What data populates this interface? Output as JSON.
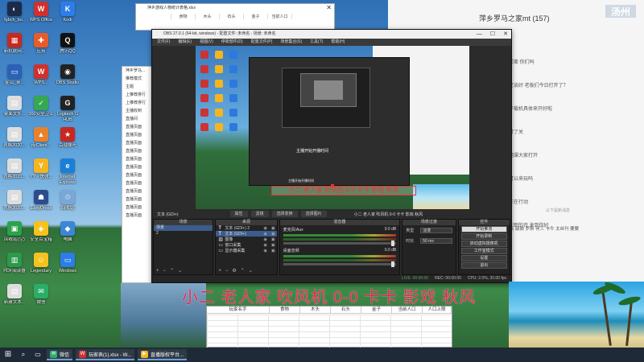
{
  "desktop": {
    "icons": [
      {
        "label": "fgbch_bo..",
        "color": "#1b2b4a",
        "glyph": "◐"
      },
      {
        "label": "WPS Office",
        "color": "#d0312d",
        "glyph": "W"
      },
      {
        "label": "Kodi",
        "color": "#2b7de9",
        "glyph": "K"
      },
      {
        "label": "新机联网...",
        "color": "#c8281f",
        "glyph": "▦"
      },
      {
        "label": "应用",
        "color": "#e85c2c",
        "glyph": "✚"
      },
      {
        "label": "腾讯QQ",
        "color": "#111111",
        "glyph": "Q"
      },
      {
        "label": "金山_桌...",
        "color": "#2b62b8",
        "glyph": "▭"
      },
      {
        "label": "WPS...",
        "color": "#d0312d",
        "glyph": "W"
      },
      {
        "label": "OBS Studio",
        "color": "#222222",
        "glyph": "◉"
      },
      {
        "label": "桌面文件...",
        "color": "#dddddd",
        "glyph": "▤"
      },
      {
        "label": "360安全卫士",
        "color": "#36a852",
        "glyph": "✓"
      },
      {
        "label": "Logitech G HUB",
        "color": "#222222",
        "glyph": "G"
      },
      {
        "label": "表格2020...",
        "color": "#dddddd",
        "glyph": "▤"
      },
      {
        "label": "dyClient...",
        "color": "#e8822c",
        "glyph": "▲"
      },
      {
        "label": "百战哪吒",
        "color": "#c8281f",
        "glyph": "★"
      },
      {
        "label": "表格2020...",
        "color": "#dddddd",
        "glyph": "▤"
      },
      {
        "label": "YY - 快速...",
        "color": "#f6b51e",
        "glyph": "Y"
      },
      {
        "label": "Internet Explorer",
        "color": "#1a7fd6",
        "glyph": "e"
      },
      {
        "label": "表格2020...",
        "color": "#dddddd",
        "glyph": "▤"
      },
      {
        "label": "EasyDress",
        "color": "#2d4c8f",
        "glyph": "☗"
      },
      {
        "label": "回收站",
        "color": "#7aa7d6",
        "glyph": "♲"
      },
      {
        "label": "回收站(空)",
        "color": "#2ba24c",
        "glyph": "▣"
      },
      {
        "label": "安全百宝箱",
        "color": "#f6c21e",
        "glyph": "◈"
      },
      {
        "label": "电脑",
        "color": "#3b86d6",
        "glyph": "◆"
      },
      {
        "label": "PDF阅读器",
        "color": "#2b9a4a",
        "glyph": "▥"
      },
      {
        "label": "Legendary",
        "color": "#f6c21e",
        "glyph": "☺"
      },
      {
        "label": "Windows",
        "color": "#2b7de9",
        "glyph": "▭"
      },
      {
        "label": "新建文本...",
        "color": "#dddddd",
        "glyph": "▤"
      },
      {
        "label": "微信",
        "color": "#2aae67",
        "glyph": "✉"
      }
    ]
  },
  "chat": {
    "title": "萍乡罗马之家mt (157)",
    "messages": [
      "前辈 你们吗",
      "老谈好 老板们今日打开了？",
      "下载机具体来开好啦",
      "打了关",
      "网课大家打开",
      "可以来玩吗",
      "正在行动",
      "在职的开 来到你好"
    ],
    "system_msg": "以下是新消息",
    "last_msg": "第三名 敲鼓 罗斯 何三 卡牛 太丝刊 要要",
    "brand": "汤州"
  },
  "excel": {
    "title": "萍乡游戏人物统计表格.xlsx",
    "headers": [
      "",
      "食物",
      "木头",
      "石头",
      "金子",
      "当前人口"
    ]
  },
  "live_panel": {
    "items": [
      "萍乡罗马...",
      "推荐模式",
      "主题",
      "上推荐排行",
      "上推荐排行",
      "主播收到",
      "直播间",
      "直播页面",
      "直播页面",
      "直播页面",
      "直播页面",
      "直播页面",
      "直播页面",
      "直播页面",
      "直播页面",
      "直播页面",
      "直播页面",
      "直播页面",
      "直播页面"
    ]
  },
  "obs": {
    "title": "OBS 27.0.1 (64-bit, windows) - 配置文件: 未命名 - 场景: 未命名",
    "menu": [
      "文件(F)",
      "编辑(E)",
      "视图(V)",
      "停靠部件(D)",
      "配置文件(P)",
      "场景集合(S)",
      "工具(T)",
      "帮助(H)"
    ],
    "preview": {
      "banner": "小二 老人家 吹风机 0-0 卡卡 影戏 秋风",
      "inner_label": "主播开始开播时间",
      "inner_label2": "主播开始开播时间"
    },
    "source_bar": {
      "scene_label": "文本 (GDI+)",
      "tools": [
        "属性",
        "滤镜"
      ],
      "transform": "选择变换",
      "filter_label": "选择图片",
      "marquee": "小二 老人家 吹风机 0-0 卡卡 影戏 秋风"
    },
    "docks": {
      "scenes": {
        "title": "场景",
        "items": [
          "场景",
          "2"
        ]
      },
      "sources": {
        "title": "来源",
        "items": [
          "文本 (GDI+) 2",
          "文本 (GDI+)",
          "图像",
          "窗口采集",
          "显示器采集"
        ]
      },
      "mixer": {
        "title": "混音器",
        "tracks": [
          {
            "name": "麦克风/Aux",
            "db": "0.0 dB"
          },
          {
            "name": "桌面音频",
            "db": "0.0 dB"
          }
        ]
      },
      "transitions": {
        "title": "场景过渡",
        "type_label": "类型",
        "type_value": "淡变",
        "duration_label": "时长",
        "duration_value": "50 ms"
      },
      "controls": {
        "title": "控件",
        "buttons": [
          "开始推流",
          "开始录制",
          "启动虚拟摄像机",
          "工作室模式",
          "设置",
          "退出"
        ]
      }
    },
    "status": {
      "live": "LIVE: 00:00:00",
      "rec": "REC: 00:00:00",
      "cpu": "CPU: 2.0%, 30.00 fps"
    }
  },
  "overlay_text": "小二 老人家 吹风机 0-0 卡卡 影戏 秋风",
  "bottom_sheet": {
    "headers": [
      "玩家名字",
      "食物",
      "木头",
      "石头",
      "金子",
      "当前人口",
      "人口上限"
    ]
  },
  "taskbar": {
    "apps": [
      {
        "label": "微信",
        "color": "#2aae67"
      },
      {
        "label": "玩家表(1).xlsx - W...",
        "color": "#d0312d"
      },
      {
        "label": "直播版权平台...",
        "color": "#f6b51e"
      }
    ]
  }
}
